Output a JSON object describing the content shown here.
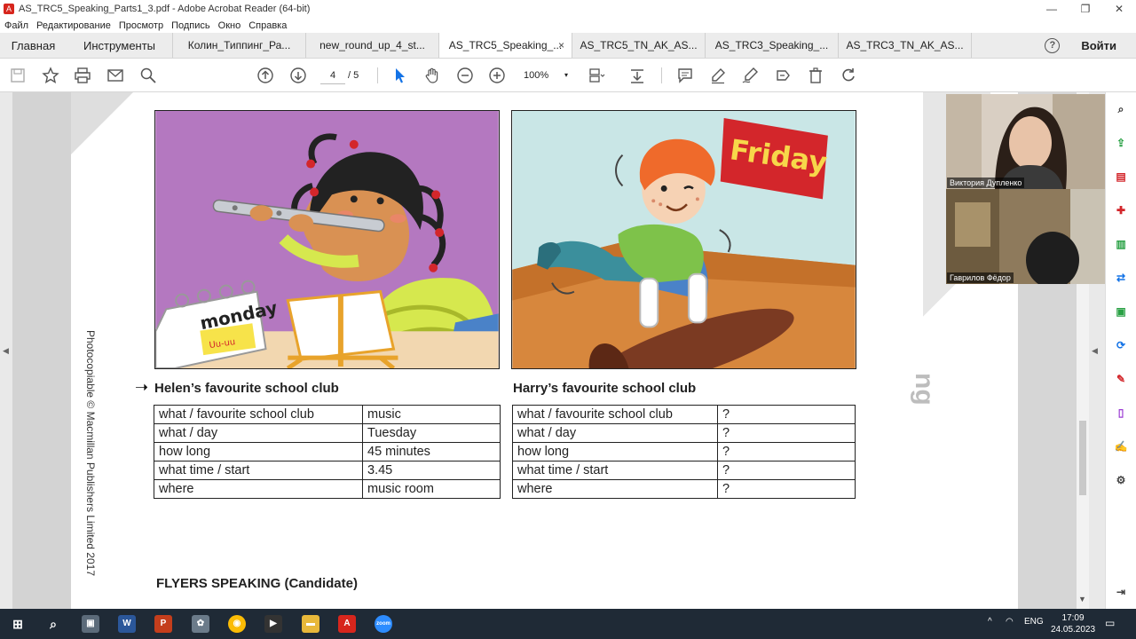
{
  "window": {
    "title": "AS_TRC5_Speaking_Parts1_3.pdf - Adobe Acrobat Reader (64-bit)",
    "min": "—",
    "max": "❐",
    "close": "✕"
  },
  "menu": [
    "Файл",
    "Редактирование",
    "Просмотр",
    "Подпись",
    "Окно",
    "Справка"
  ],
  "tabs": {
    "home": "Главная",
    "tools": "Инструменты",
    "docs": [
      "Колин_Типпинг_Ра...",
      "new_round_up_4_st...",
      "AS_TRC5_Speaking_...",
      "AS_TRC5_TN_AK_AS...",
      "AS_TRC3_Speaking_...",
      "AS_TRC3_TN_AK_AS..."
    ],
    "active_index": 2,
    "close_glyph": "×",
    "help": "?",
    "login": "Войти"
  },
  "toolbar": {
    "page_current": "4",
    "page_total": "/ 5",
    "zoom": "100%",
    "zoom_caret": "▾"
  },
  "document": {
    "fold_text": "ng",
    "left_picture": {
      "calendar_day": "monday",
      "calendar_note": "Uu-uu"
    },
    "right_picture": {
      "sign_day": "Friday"
    },
    "left_heading": "Helen’s favourite school club",
    "right_heading": "Harry’s favourite school club",
    "left_table": [
      [
        "what / favourite school club",
        "music"
      ],
      [
        "what / day",
        "Tuesday"
      ],
      [
        "how long",
        "45 minutes"
      ],
      [
        "what time / start",
        "3.45"
      ],
      [
        "where",
        "music room"
      ]
    ],
    "right_table": [
      [
        "what / favourite school club",
        "?"
      ],
      [
        "what / day",
        "?"
      ],
      [
        "how long",
        "?"
      ],
      [
        "what time / start",
        "?"
      ],
      [
        "where",
        "?"
      ]
    ],
    "copyright": "Photocopiable © Macmillan Publishers Limited 2017",
    "footer": "FLYERS SPEAKING (Candidate)",
    "nav_left": "◀",
    "nav_right": "◀",
    "scroll_down": "▼"
  },
  "video": {
    "participant_1": "Виктория Дупленко",
    "participant_2": "Гаврилов Фёдор"
  },
  "taskbar": {
    "lang": "ENG",
    "time": "17:09",
    "date": "24.05.2023",
    "tray_up": "^",
    "apps": [
      "W",
      "P",
      "zoom"
    ]
  }
}
